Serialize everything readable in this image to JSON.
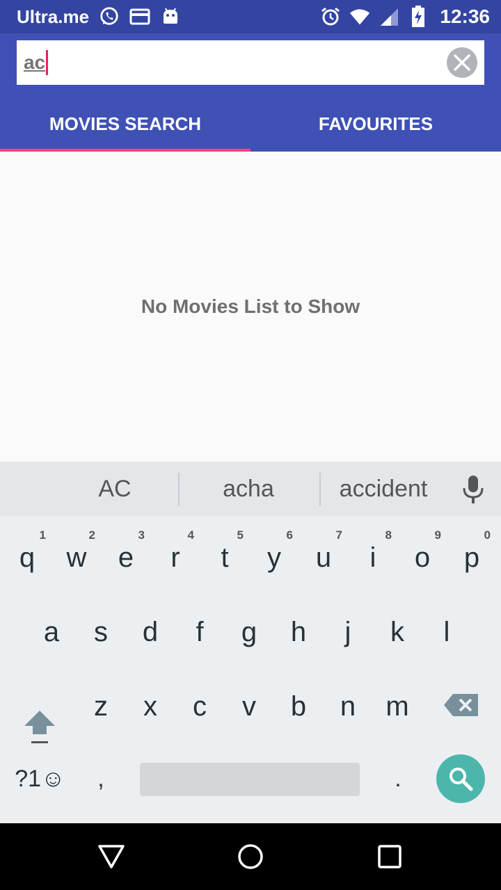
{
  "status_bar": {
    "app_name": "Ultra.me",
    "time": "12:36",
    "icons": [
      "whatsapp-icon",
      "card-icon",
      "android-icon",
      "alarm-icon",
      "wifi-icon",
      "signal-icon",
      "battery-charging-icon"
    ]
  },
  "search": {
    "value": "ac"
  },
  "tabs": [
    {
      "label": "MOVIES SEARCH",
      "active": true
    },
    {
      "label": "FAVOURITES",
      "active": false
    }
  ],
  "content": {
    "empty_message": "No Movies List to Show"
  },
  "keyboard": {
    "suggestions": [
      "AC",
      "acha",
      "accident"
    ],
    "row1": [
      "q",
      "w",
      "e",
      "r",
      "t",
      "y",
      "u",
      "i",
      "o",
      "p"
    ],
    "row1_hints": [
      "1",
      "2",
      "3",
      "4",
      "5",
      "6",
      "7",
      "8",
      "9",
      "0"
    ],
    "row2": [
      "a",
      "s",
      "d",
      "f",
      "g",
      "h",
      "j",
      "k",
      "l"
    ],
    "row3": [
      "z",
      "x",
      "c",
      "v",
      "b",
      "n",
      "m"
    ],
    "symbols_label": "?1☺",
    "comma": ",",
    "period": "."
  },
  "colors": {
    "status_bar": "#3345a0",
    "app_bar": "#3f51b5",
    "tab_indicator": "#ff4081",
    "search_key": "#4db6ac"
  }
}
